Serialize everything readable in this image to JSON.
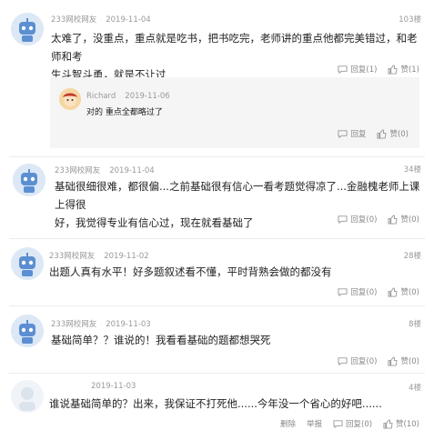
{
  "comments": [
    {
      "user": "233网校网友",
      "date": "2019-11-04",
      "floor": "103楼",
      "text_line1": "太难了，没重点，重点就是吃书，把书吃完，老师讲的重点他都完美错过，和老师和考",
      "text_line2": "生斗智斗勇，就是不让过",
      "reply_label": "回复(1)",
      "like_label": "赞(1)",
      "reply": {
        "user": "Richard",
        "date": "2019-11-06",
        "text": "对的 重点全都略过了",
        "reply_label": "回复",
        "like_label": "赞(0)"
      }
    },
    {
      "user": "233网校网友",
      "date": "2019-11-04",
      "floor": "34楼",
      "text_line1": "基础很细很难，都很偏...之前基础很有信心一看考题觉得凉了...金融槐老师上课上得很",
      "text_line2": "好，我觉得专业有信心过，现在就看基础了",
      "reply_label": "回复(0)",
      "like_label": "赞(0)"
    },
    {
      "user": "233网校网友",
      "date": "2019-11-02",
      "floor": "28楼",
      "text_line1": "出题人真有水平！好多题叙述看不懂，平时背熟会做的都没有",
      "reply_label": "回复(0)",
      "like_label": "赞(0)"
    },
    {
      "user": "233网校网友",
      "date": "2019-11-03",
      "floor": "8楼",
      "text_line1": "基础简单？？谁说的！我看看基础的题都想哭死",
      "reply_label": "回复(0)",
      "like_label": "赞(0)"
    },
    {
      "user": "",
      "date": "2019-11-03",
      "floor": "4楼",
      "text_line1": "谁说基础简单的？出来，我保证不打死他......今年没一个省心的好吧......",
      "delete_label": "删除",
      "report_label": "举报",
      "reply_label": "回复(0)",
      "like_label": "赞(10)"
    }
  ]
}
